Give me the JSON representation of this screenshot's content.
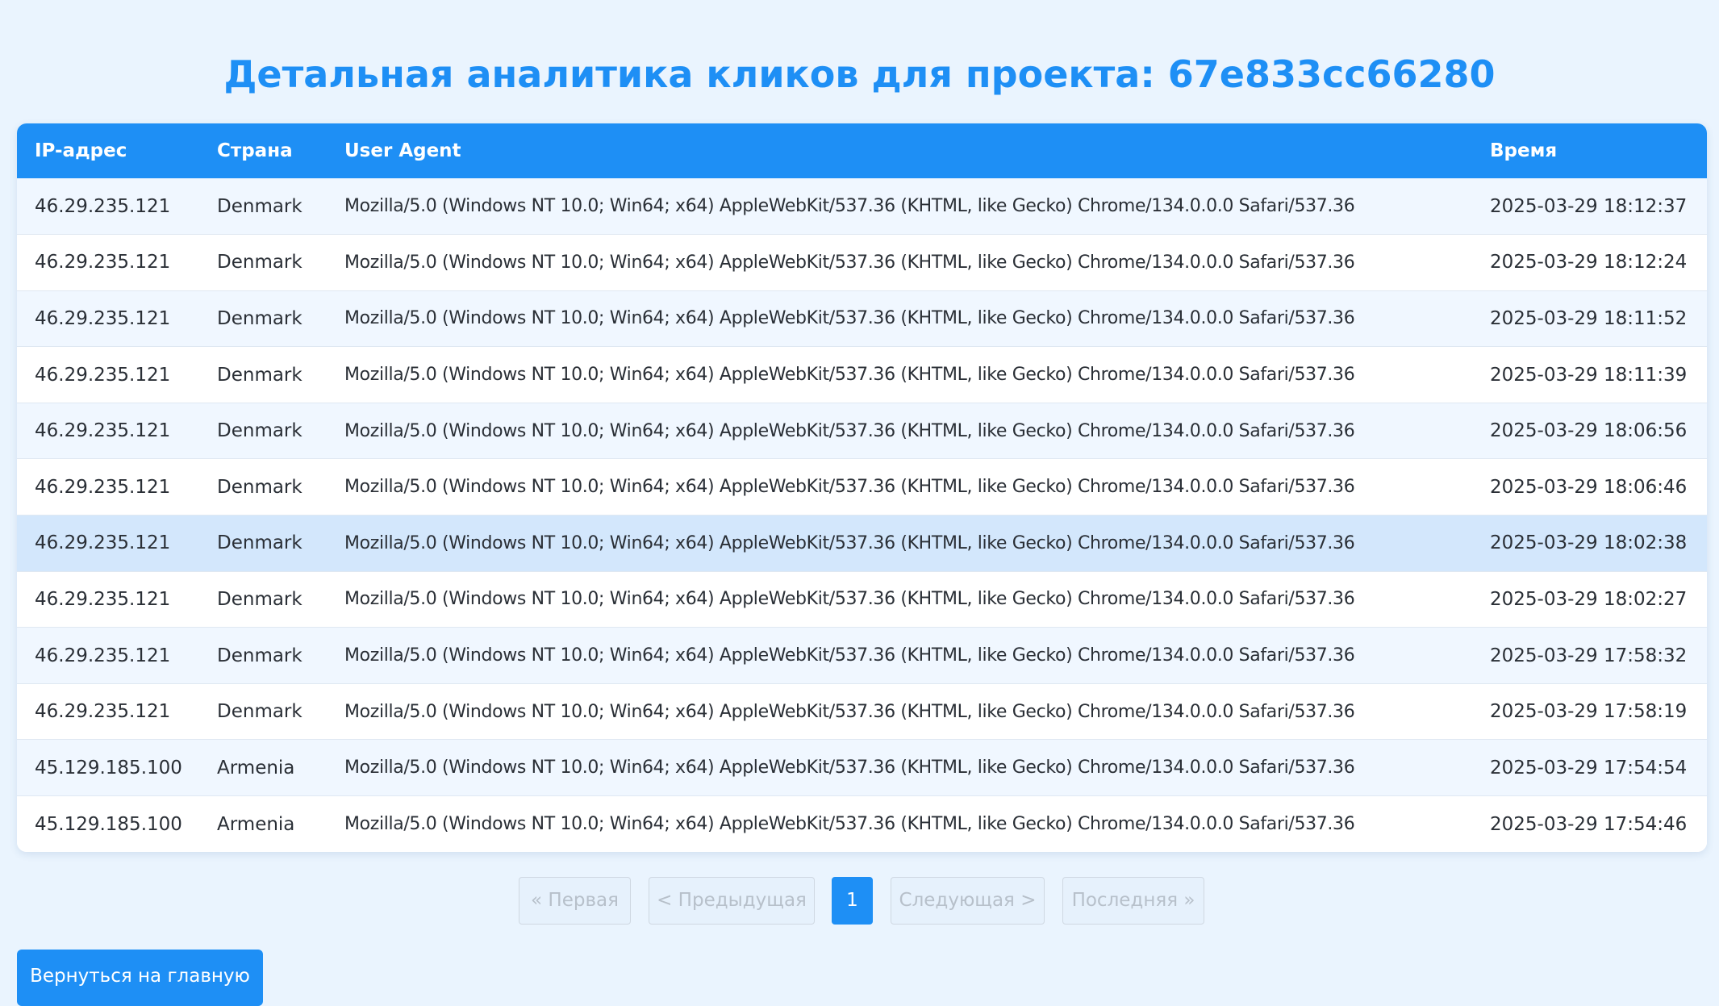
{
  "page": {
    "title": "Детальная аналитика кликов для проекта: 67e833cc66280"
  },
  "table": {
    "headers": {
      "ip": "IP-адрес",
      "country": "Страна",
      "user_agent": "User Agent",
      "time": "Время"
    },
    "rows": [
      {
        "ip": "46.29.235.121",
        "country": "Denmark",
        "user_agent": "Mozilla/5.0 (Windows NT 10.0; Win64; x64) AppleWebKit/537.36 (KHTML, like Gecko) Chrome/134.0.0.0 Safari/537.36",
        "time": "2025-03-29 18:12:37"
      },
      {
        "ip": "46.29.235.121",
        "country": "Denmark",
        "user_agent": "Mozilla/5.0 (Windows NT 10.0; Win64; x64) AppleWebKit/537.36 (KHTML, like Gecko) Chrome/134.0.0.0 Safari/537.36",
        "time": "2025-03-29 18:12:24"
      },
      {
        "ip": "46.29.235.121",
        "country": "Denmark",
        "user_agent": "Mozilla/5.0 (Windows NT 10.0; Win64; x64) AppleWebKit/537.36 (KHTML, like Gecko) Chrome/134.0.0.0 Safari/537.36",
        "time": "2025-03-29 18:11:52"
      },
      {
        "ip": "46.29.235.121",
        "country": "Denmark",
        "user_agent": "Mozilla/5.0 (Windows NT 10.0; Win64; x64) AppleWebKit/537.36 (KHTML, like Gecko) Chrome/134.0.0.0 Safari/537.36",
        "time": "2025-03-29 18:11:39"
      },
      {
        "ip": "46.29.235.121",
        "country": "Denmark",
        "user_agent": "Mozilla/5.0 (Windows NT 10.0; Win64; x64) AppleWebKit/537.36 (KHTML, like Gecko) Chrome/134.0.0.0 Safari/537.36",
        "time": "2025-03-29 18:06:56"
      },
      {
        "ip": "46.29.235.121",
        "country": "Denmark",
        "user_agent": "Mozilla/5.0 (Windows NT 10.0; Win64; x64) AppleWebKit/537.36 (KHTML, like Gecko) Chrome/134.0.0.0 Safari/537.36",
        "time": "2025-03-29 18:06:46"
      },
      {
        "ip": "46.29.235.121",
        "country": "Denmark",
        "user_agent": "Mozilla/5.0 (Windows NT 10.0; Win64; x64) AppleWebKit/537.36 (KHTML, like Gecko) Chrome/134.0.0.0 Safari/537.36",
        "time": "2025-03-29 18:02:38"
      },
      {
        "ip": "46.29.235.121",
        "country": "Denmark",
        "user_agent": "Mozilla/5.0 (Windows NT 10.0; Win64; x64) AppleWebKit/537.36 (KHTML, like Gecko) Chrome/134.0.0.0 Safari/537.36",
        "time": "2025-03-29 18:02:27"
      },
      {
        "ip": "46.29.235.121",
        "country": "Denmark",
        "user_agent": "Mozilla/5.0 (Windows NT 10.0; Win64; x64) AppleWebKit/537.36 (KHTML, like Gecko) Chrome/134.0.0.0 Safari/537.36",
        "time": "2025-03-29 17:58:32"
      },
      {
        "ip": "46.29.235.121",
        "country": "Denmark",
        "user_agent": "Mozilla/5.0 (Windows NT 10.0; Win64; x64) AppleWebKit/537.36 (KHTML, like Gecko) Chrome/134.0.0.0 Safari/537.36",
        "time": "2025-03-29 17:58:19"
      },
      {
        "ip": "45.129.185.100",
        "country": "Armenia",
        "user_agent": "Mozilla/5.0 (Windows NT 10.0; Win64; x64) AppleWebKit/537.36 (KHTML, like Gecko) Chrome/134.0.0.0 Safari/537.36",
        "time": "2025-03-29 17:54:54"
      },
      {
        "ip": "45.129.185.100",
        "country": "Armenia",
        "user_agent": "Mozilla/5.0 (Windows NT 10.0; Win64; x64) AppleWebKit/537.36 (KHTML, like Gecko) Chrome/134.0.0.0 Safari/537.36",
        "time": "2025-03-29 17:54:46"
      }
    ]
  },
  "pagination": {
    "first_label": "« Первая",
    "prev_label": "< Предыдущая",
    "current_page": "1",
    "next_label": "Следующая >",
    "last_label": "Последняя »"
  },
  "actions": {
    "back_label": "Вернуться на главную"
  },
  "colors": {
    "accent": "#1e8ff5",
    "background": "#eaf4fe",
    "row_alt": "#f0f7ff",
    "row_hover": "#d3e7fc",
    "disabled_text": "#b7c0ca"
  }
}
